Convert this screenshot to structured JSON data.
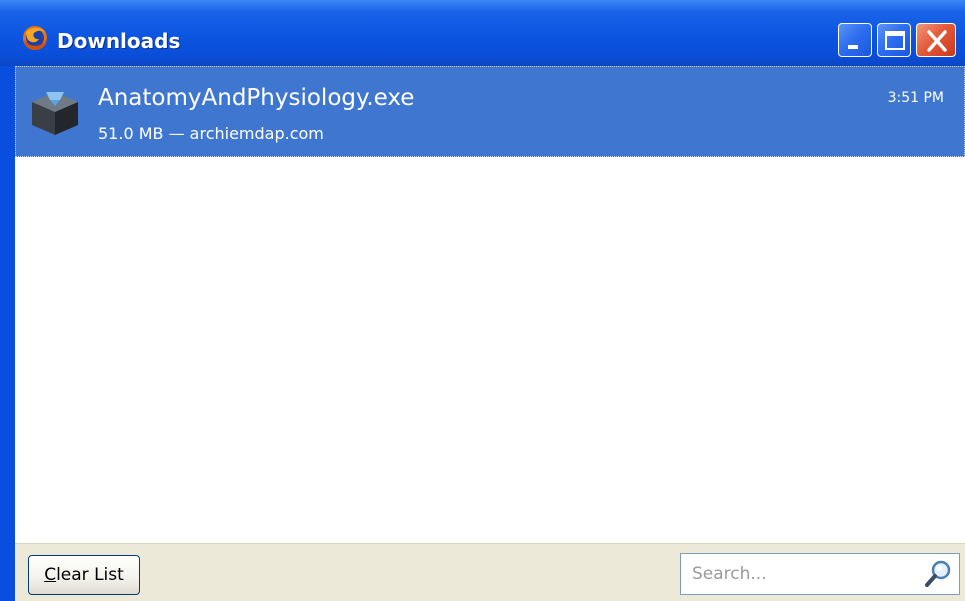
{
  "window": {
    "title": "Downloads",
    "app_icon": "firefox-icon",
    "controls": {
      "minimize": "minimize-icon",
      "maximize": "maximize-icon",
      "close": "close-icon"
    }
  },
  "downloads": [
    {
      "file_name": "AnatomyAndPhysiology.exe",
      "status": "51.0 MB — archiemdap.com",
      "time": "3:51 PM",
      "icon": "executable-file-icon"
    }
  ],
  "footer": {
    "clear_button": {
      "mnemonic": "C",
      "rest": "lear List"
    },
    "search": {
      "placeholder": "Search...",
      "value": "",
      "icon": "magnifier-icon"
    }
  },
  "colors": {
    "titlebar": "#0b55e2",
    "selection": "#3f77d0",
    "close_button": "#e45b3a",
    "footer_background": "#ece9d8"
  }
}
